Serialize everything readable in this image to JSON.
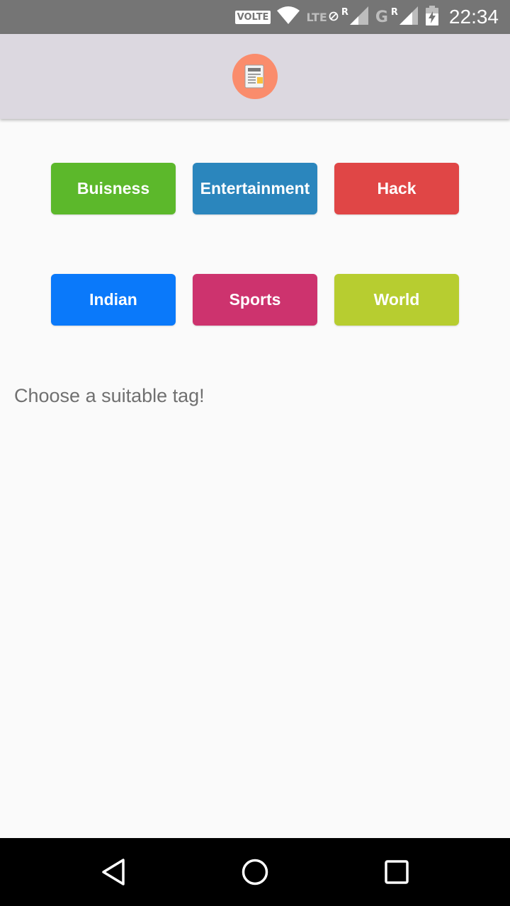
{
  "status_bar": {
    "volte_label": "VOLTE",
    "net_lte": "LTE",
    "roaming_1": "R",
    "net_g": "G",
    "roaming_2": "R",
    "time": "22:34"
  },
  "app_bar": {
    "logo_icon": "newspaper-icon"
  },
  "tags": [
    {
      "label": "Buisness",
      "color": "#5cb82b"
    },
    {
      "label": "Entertainment",
      "color": "#2b86bd"
    },
    {
      "label": "Hack",
      "color": "#e04646"
    },
    {
      "label": "Indian",
      "color": "#0a79fa"
    },
    {
      "label": "Sports",
      "color": "#cd336e"
    },
    {
      "label": "World",
      "color": "#b7cd30"
    }
  ],
  "hint_text": "Choose a suitable tag!",
  "nav_bar": {
    "back_icon": "back-triangle-icon",
    "home_icon": "home-circle-icon",
    "recents_icon": "recents-square-icon"
  }
}
